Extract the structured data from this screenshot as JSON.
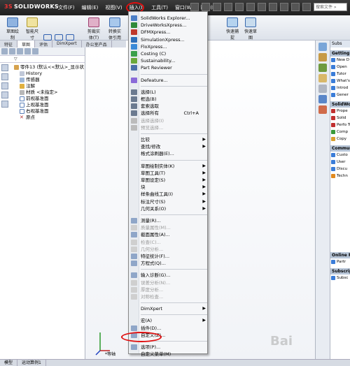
{
  "app": {
    "logo_text": "SOLIDWORKS",
    "logo_prefix": "3S"
  },
  "menubar": [
    "文件(F)",
    "编辑(E)",
    "视图(V)",
    "插入(I)",
    "工具(T)",
    "窗口(W)",
    "帮助(H)"
  ],
  "search": {
    "placeholder": "搜索文件 »"
  },
  "ribbon": {
    "sketch": "草图绘\n制",
    "smart_dim": "智能尺\n寸",
    "trim": "剪裁实\n体(T)",
    "convert": "转换实\n体引用",
    "fast_capture": "快速捕\n捉",
    "fast_sketch": "快速草\n图"
  },
  "tabs": [
    "特征",
    "草图",
    "评估",
    "DimXpert",
    "办公室产品"
  ],
  "tree": {
    "root": "零件13 (默认<<默认>_显示状",
    "items": [
      "History",
      "传感器",
      "注解",
      "材质 <未指定>",
      "前视基准面",
      "上视基准面",
      "右视基准面",
      "原点"
    ]
  },
  "dropdown": {
    "items": [
      {
        "label": "SolidWorks Explorer...",
        "disabled": false
      },
      {
        "label": "DriveWorksXpress...",
        "disabled": false
      },
      {
        "label": "DFMXpress...",
        "disabled": false
      },
      {
        "label": "SimulationXpress...",
        "disabled": false
      },
      {
        "label": "FloXpress...",
        "disabled": false
      },
      {
        "label": "Costing (C)",
        "disabled": false
      },
      {
        "label": "Sustainability...",
        "disabled": false
      },
      {
        "label": "Part Reviewer",
        "disabled": false
      },
      {
        "label": "Defeature...",
        "disabled": false
      },
      {
        "label": "选择(L)",
        "disabled": false
      },
      {
        "label": "框选(B)",
        "disabled": false
      },
      {
        "label": "套索选取",
        "disabled": false
      },
      {
        "label": "选择所有",
        "shortcut": "Ctrl+A",
        "disabled": false
      },
      {
        "label": "选择选择(I)",
        "disabled": true
      },
      {
        "label": "预览选择...",
        "disabled": true
      },
      {
        "label": "比较",
        "submenu": true,
        "disabled": false
      },
      {
        "label": "查找/修改",
        "submenu": true,
        "disabled": false
      },
      {
        "label": "格式涂刷器(E)...",
        "disabled": false
      },
      {
        "label": "草图绘制实体(K)",
        "submenu": true,
        "disabled": false
      },
      {
        "label": "草图工具(T)",
        "submenu": true,
        "disabled": false
      },
      {
        "label": "草图设定(S)",
        "submenu": true,
        "disabled": false
      },
      {
        "label": "块",
        "submenu": true,
        "disabled": false
      },
      {
        "label": "样条曲线工具(I)",
        "submenu": true,
        "disabled": false
      },
      {
        "label": "标注尺寸(S)",
        "submenu": true,
        "disabled": false
      },
      {
        "label": "几何关系(O)",
        "submenu": true,
        "disabled": false
      },
      {
        "label": "测量(R)...",
        "disabled": false
      },
      {
        "label": "质量属性(M)...",
        "disabled": true
      },
      {
        "label": "截面属性(A)...",
        "disabled": false
      },
      {
        "label": "检查(C)...",
        "disabled": true
      },
      {
        "label": "几何分析...",
        "disabled": true
      },
      {
        "label": "特征统计(F)...",
        "disabled": false
      },
      {
        "label": "方程式(Q)...",
        "disabled": false
      },
      {
        "label": "输入诊断(G)...",
        "disabled": false
      },
      {
        "label": "误差分析(N)...",
        "disabled": true
      },
      {
        "label": "厚度分析...",
        "disabled": true
      },
      {
        "label": "对称检查...",
        "disabled": true
      },
      {
        "label": "DimXpert",
        "submenu": true,
        "disabled": false
      },
      {
        "label": "宏(A)",
        "submenu": true,
        "disabled": false
      },
      {
        "label": "插件(D)...",
        "disabled": false
      },
      {
        "label": "自定义(Z)...",
        "disabled": false
      },
      {
        "label": "选项(P)...",
        "disabled": false
      },
      {
        "label": "自定义菜单(M)",
        "disabled": false
      }
    ]
  },
  "taskpane": {
    "header": "Subs",
    "getting_started": "Getting S",
    "gs_items": [
      "New D",
      "Open",
      "Tutor",
      "What's",
      "Introd",
      "Gener"
    ],
    "solidworks": "SolidWorks",
    "sw_items": [
      "Prope",
      "Solid",
      "Perfo Test",
      "Comp",
      "Copy"
    ],
    "community": "Communit",
    "cm_items": [
      "Custo",
      "User",
      "Discu",
      "Techn"
    ],
    "online": "Online Re",
    "online_items": [
      "Partr"
    ],
    "subscription": "Subscript",
    "sub_items": [
      "Subsc"
    ]
  },
  "statusbar": [
    "模型",
    "运动算例1"
  ],
  "triad_label": "*等轴",
  "watermark": "Bai"
}
